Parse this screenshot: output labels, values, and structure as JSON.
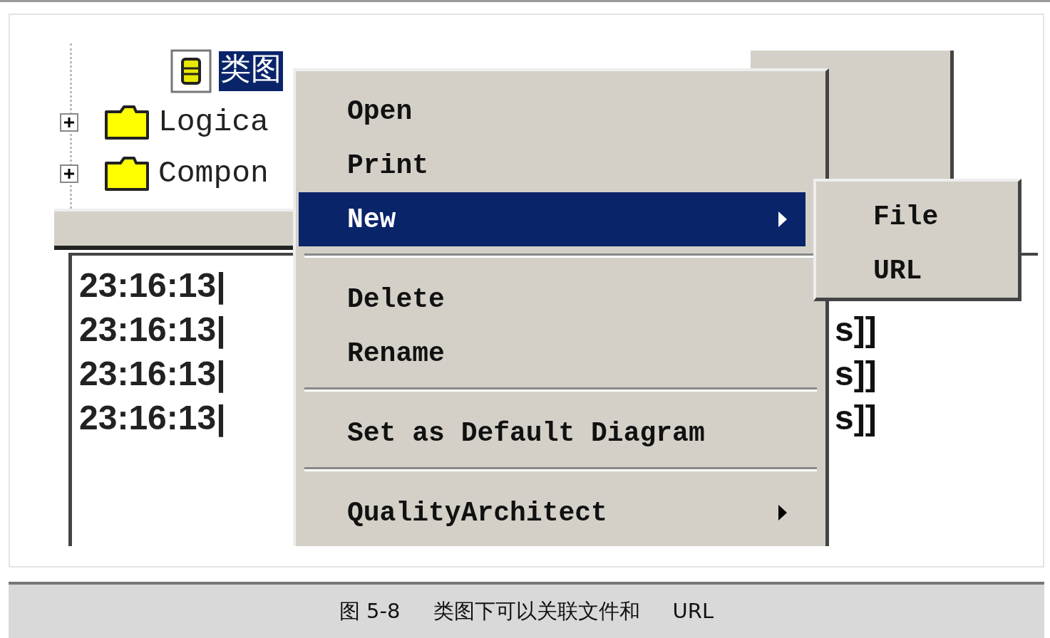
{
  "tree": {
    "items": [
      {
        "label": "类图",
        "kind": "diagram",
        "selected": true
      },
      {
        "label": "Logica",
        "kind": "folder",
        "expanded": false,
        "selected": false
      },
      {
        "label": "Compon",
        "kind": "folder",
        "expanded": false,
        "selected": false
      }
    ]
  },
  "log": {
    "rows": [
      {
        "time": "23:16:13|"
      },
      {
        "time": "23:16:13|",
        "tail": "s]]"
      },
      {
        "time": "23:16:13|",
        "tail": "s]]"
      },
      {
        "time": "23:16:13|",
        "tail": "s]]"
      }
    ]
  },
  "context_menu": {
    "items": [
      {
        "kind": "item",
        "label": "Open",
        "selected": false,
        "has_submenu": false
      },
      {
        "kind": "item",
        "label": "Print",
        "selected": false,
        "has_submenu": false
      },
      {
        "kind": "item",
        "label": "New",
        "selected": true,
        "has_submenu": true
      },
      {
        "kind": "separator"
      },
      {
        "kind": "item",
        "label": "Delete",
        "selected": false,
        "has_submenu": false
      },
      {
        "kind": "item",
        "label": "Rename",
        "selected": false,
        "has_submenu": false
      },
      {
        "kind": "separator"
      },
      {
        "kind": "item",
        "label": "Set as Default Diagram",
        "selected": false,
        "has_submenu": false
      },
      {
        "kind": "separator"
      },
      {
        "kind": "item",
        "label": "QualityArchitect",
        "selected": false,
        "has_submenu": true
      }
    ]
  },
  "submenu": {
    "items": [
      {
        "label": "File",
        "selected": false
      },
      {
        "label": "URL",
        "selected": false
      }
    ]
  },
  "caption": "图 5-8     类图下可以关联文件和     URL"
}
